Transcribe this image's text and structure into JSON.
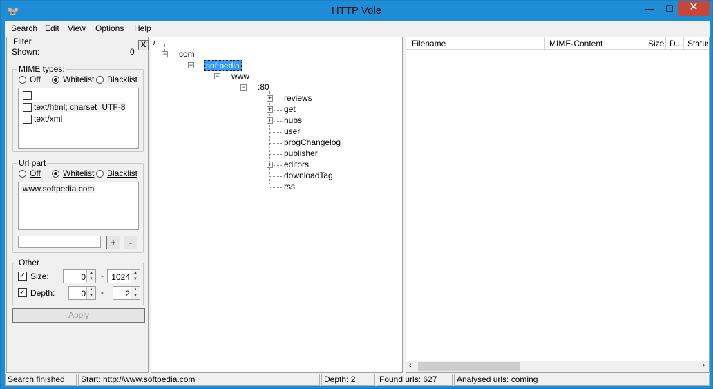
{
  "window": {
    "title": "HTTP Vole",
    "min_glyph": "—",
    "max_glyph": "☐",
    "close_glyph": "✕",
    "icon": "vole-app-icon"
  },
  "menu": [
    "Search",
    "Edit",
    "View",
    "Options",
    "Help"
  ],
  "filter": {
    "title": "Filter",
    "shown_label": "Shown:",
    "shown_value": "0",
    "close_glyph": "X",
    "mime": {
      "title": "MIME types:",
      "off": "Off",
      "whitelist": "Whitelist",
      "blacklist": "Blacklist",
      "selected": "whitelist",
      "items": [
        "",
        "text/html; charset=UTF-8",
        "text/xml"
      ]
    },
    "url": {
      "title": "Url part",
      "off": "Off",
      "whitelist": "Whitelist",
      "blacklist": "Blacklist",
      "selected": "whitelist",
      "items": [
        "www.softpedia.com"
      ],
      "input_value": "",
      "add_label": "+",
      "remove_label": "-"
    },
    "other": {
      "title": "Other",
      "size_label": "Size:",
      "size_checked": true,
      "size_min": "0",
      "size_max": "1024",
      "depth_label": "Depth:",
      "depth_checked": true,
      "depth_min": "0",
      "depth_max": "2",
      "dash": "-"
    },
    "apply_label": "Apply"
  },
  "tree": {
    "root": "/",
    "com": "com",
    "softpedia": "softpedia",
    "www": "www",
    "port": ":80",
    "children": [
      "reviews",
      "get",
      "hubs",
      "user",
      "progChangelog",
      "publisher",
      "editors",
      "downloadTag",
      "rss"
    ]
  },
  "list": {
    "columns": [
      "Filename",
      "MIME-Content",
      "Size",
      "D...",
      "Status"
    ],
    "rows": []
  },
  "status": {
    "state": "Search finished",
    "start": "Start: http://www.softpedia.com",
    "depth": "Depth: 2",
    "found": "Found urls: 627",
    "analysed": "Analysed urls: coming"
  }
}
